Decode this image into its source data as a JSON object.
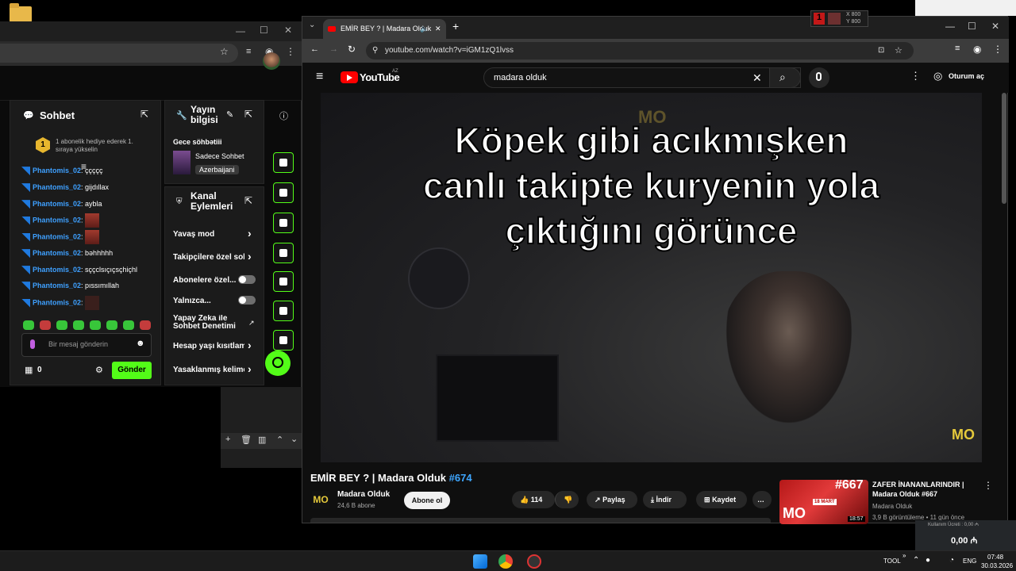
{
  "colors": {
    "kick_green": "#53fc18",
    "yt_red": "#ff0000",
    "link_blue": "#3ea6ff"
  },
  "kick": {
    "chat": {
      "title": "Sohbet",
      "gift_text_1": "1 abonelik hediye ederek 1.",
      "gift_text_2": "sıraya yükselin",
      "gift_rank": "1",
      "messages": [
        {
          "user": "Phantomis_02",
          "text": "ççççç"
        },
        {
          "user": "Phantomis_02",
          "text": "gijdıllax"
        },
        {
          "user": "Phantomis_02",
          "text": "aybla"
        },
        {
          "user": "Phantomis_02",
          "text": ""
        },
        {
          "user": "Phantomis_02",
          "text": ""
        },
        {
          "user": "Phantomis_02",
          "text": "bəhhhhh"
        },
        {
          "user": "Phantomis_02",
          "text": "sççclsıçıçsçhiçhl"
        },
        {
          "user": "Phantomis_02",
          "text": "pıssımıllah"
        },
        {
          "user": "Phantomis_02",
          "text": ""
        }
      ],
      "input_placeholder": "Bir mesaj gönderin",
      "points": "0",
      "send_label": "Gönder"
    },
    "stream_info": {
      "title_1": "Yayın",
      "title_2": "bilgisi",
      "stream_title": "Gece söhbətiii",
      "category": "Sadece Sohbet",
      "language_tag": "Azerbaijani"
    },
    "channel_actions": {
      "title_1": "Kanal",
      "title_2": "Eylemleri",
      "items": [
        {
          "label": "Yavaş mod",
          "control": "chevron"
        },
        {
          "label": "Takipçilere özel soh",
          "control": "chevron"
        },
        {
          "label": "Abonelere özel...",
          "control": "toggle"
        },
        {
          "label": "Yalnızca...",
          "control": "toggle"
        },
        {
          "label": "Yapay Zeka ile",
          "label2": "Sohbet Denetimi",
          "control": "external"
        },
        {
          "label": "Hesap yaşı kısıtlama",
          "control": "chevron"
        },
        {
          "label": "Yasaklanmış kelimel",
          "control": "chevron"
        }
      ]
    }
  },
  "youtube": {
    "tab_title": "EMİR BEY ? | Madara Olduk",
    "url": "youtube.com/watch?v=iGM1zQ1lvss",
    "logo_text": "YouTube",
    "logo_region": "AZ",
    "search_query": "madara olduk",
    "sign_in": "Oturum aç",
    "video_caption": [
      "Köpek gibi acıkmışken",
      "canlı takipte kuryenin yola",
      "çıktığını görünce"
    ],
    "watermark": "MO",
    "video_title": "EMİR BEY ? | Madara Olduk",
    "video_hashtag": "#674",
    "channel_name": "Madara Olduk",
    "subscribers": "24,6 B abone",
    "subscribe_label": "Abone ol",
    "likes": "114",
    "share_label": "Paylaş",
    "download_label": "İndir",
    "save_label": "Kaydet",
    "related": {
      "title_1": "ZAFER İNANANLARINDIR |",
      "title_2": "Madara Olduk #667",
      "channel": "Madara Olduk",
      "meta": "3,9 B görüntüleme • 11 gün önce",
      "thumb_tag": "#667",
      "thumb_date": "18 MART",
      "duration": "18:57"
    }
  },
  "overlay": {
    "x": "X 800",
    "y": "Y 800",
    "num": "1"
  },
  "side_widget": {
    "label": "Kullanım Ücreti : 0,00 ₼",
    "amount": "0,00 ₼"
  },
  "taskbar": {
    "tool_label": "TOOL",
    "lang": "ENG",
    "time": "07:48",
    "date": "30.03.2026"
  }
}
